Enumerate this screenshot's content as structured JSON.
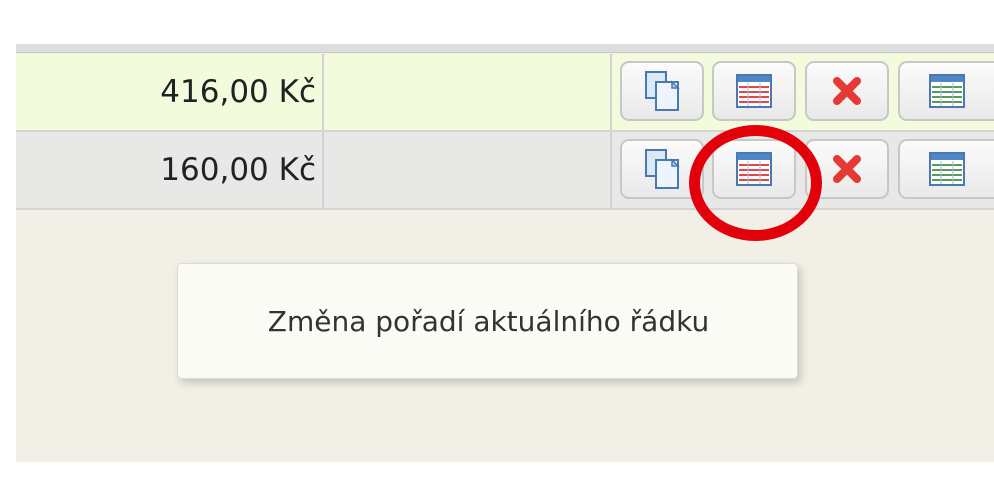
{
  "rows": [
    {
      "amount": "416,00 Kč"
    },
    {
      "amount": "160,00 Kč"
    }
  ],
  "actions": {
    "copy": {
      "icon": "copy-icon"
    },
    "reorder": {
      "icon": "table-reorder-icon"
    },
    "delete": {
      "icon": "delete-x-icon"
    },
    "detail": {
      "icon": "table-detail-icon"
    }
  },
  "tooltip": {
    "text": "Změna pořadí aktuálního řádku"
  },
  "colors": {
    "row_highlight": "#f2fbdc",
    "row_normal": "#e8e8e6",
    "delete": "#e53935",
    "annotation": "#e2000a"
  }
}
